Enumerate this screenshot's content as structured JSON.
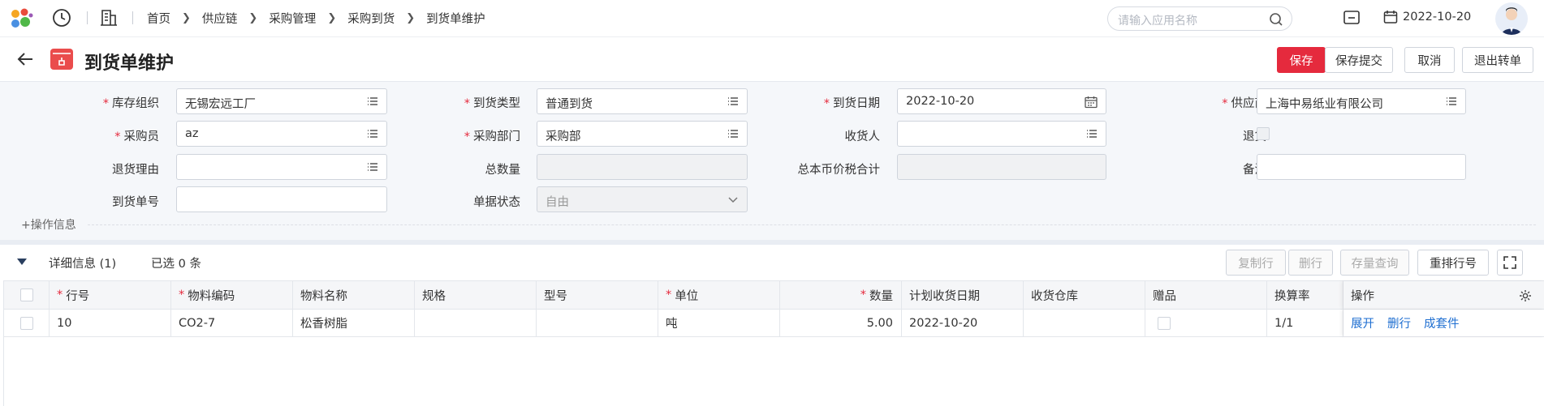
{
  "topbar": {
    "breadcrumbs": [
      "首页",
      "供应链",
      "采购管理",
      "采购到货",
      "到货单维护"
    ],
    "search_placeholder": "请输入应用名称",
    "date": "2022-10-20"
  },
  "title": "到货单维护",
  "buttons": {
    "save": "保存",
    "save_submit": "保存提交",
    "cancel": "取消",
    "exit": "退出转单"
  },
  "colors": {
    "accent": "#e52a3d",
    "link": "#1f6fd1",
    "form_bg": "#f5f7fa"
  },
  "form": {
    "inventory_org": {
      "label": "库存组织",
      "value": "无锡宏远工厂"
    },
    "arrival_type": {
      "label": "到货类型",
      "value": "普通到货"
    },
    "arrival_date": {
      "label": "到货日期",
      "value": "2022-10-20"
    },
    "supplier": {
      "label": "供应商",
      "value": "上海中易纸业有限公司"
    },
    "buyer": {
      "label": "采购员",
      "value": "az"
    },
    "purchase_dept": {
      "label": "采购部门",
      "value": "采购部"
    },
    "receiver": {
      "label": "收货人",
      "value": ""
    },
    "return": {
      "label": "退货"
    },
    "return_reason": {
      "label": "退货理由",
      "value": ""
    },
    "total_qty": {
      "label": "总数量",
      "value": ""
    },
    "total_amount": {
      "label": "总本币价税合计",
      "value": ""
    },
    "remark": {
      "label": "备注",
      "value": ""
    },
    "arrival_no": {
      "label": "到货单号",
      "value": ""
    },
    "doc_status": {
      "label": "单据状态",
      "value": "自由"
    },
    "op_info": "+操作信息"
  },
  "detail": {
    "title": "详细信息 (1)",
    "selected": "已选 0 条",
    "buttons": {
      "copy_row": "复制行",
      "delete_row": "删行",
      "stock_query": "存量查询",
      "renumber": "重排行号"
    },
    "columns": [
      "行号",
      "物料编码",
      "物料名称",
      "规格",
      "型号",
      "单位",
      "数量",
      "计划收货日期",
      "收货仓库",
      "赠品",
      "换算率",
      "操作"
    ],
    "rows": [
      {
        "line": "10",
        "code": "CO2-7",
        "name": "松香树脂",
        "spec": "",
        "model": "",
        "unit": "吨",
        "qty": "5.00",
        "plan_date": "2022-10-20",
        "warehouse": "",
        "conv": "1/1",
        "actions": [
          "展开",
          "删行",
          "成套件"
        ]
      }
    ]
  }
}
